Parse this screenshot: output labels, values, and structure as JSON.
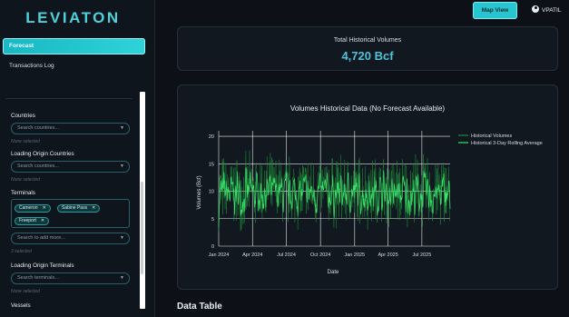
{
  "sidebar": {
    "brand": "LEVIATON",
    "nav": [
      {
        "label": "Forecast",
        "active": true
      },
      {
        "label": "Transactions Log",
        "active": false
      }
    ],
    "filters": {
      "countries": {
        "label": "Countries",
        "placeholder": "Search countries...",
        "hint": "None selected"
      },
      "loading_origin_countries": {
        "label": "Loading Origin Countries",
        "placeholder": "Search countries...",
        "hint": "None selected"
      },
      "terminals": {
        "label": "Terminals",
        "tags": [
          "Cameron",
          "Sabine Pass",
          "Freeport"
        ],
        "add_placeholder": "Search to add more...",
        "hint": "3 selected"
      },
      "loading_origin_terminals": {
        "label": "Loading Origin Terminals",
        "placeholder": "Search terminals...",
        "hint": "None selected"
      },
      "vessels": {
        "label": "Vessels"
      }
    }
  },
  "header": {
    "map_button": "Map View",
    "user": "VPATIL",
    "user_icon": "user-circle-icon"
  },
  "kpi": {
    "label": "Total Historical Volumes",
    "value": "4,720 Bcf"
  },
  "chart_data": {
    "type": "line",
    "title": "Volumes Historical Data (No Forecast Available)",
    "xlabel": "Date",
    "ylabel": "Volumes (Bcf)",
    "x_start": "2024-01-01",
    "x_end": "2025-09-15",
    "xticks": [
      "Jan 2024",
      "Apr 2024",
      "Jul 2024",
      "Oct 2024",
      "Jan 2025",
      "Apr 2025",
      "Jul 2025"
    ],
    "ylim": [
      0,
      21
    ],
    "yticks": [
      0,
      5,
      10,
      15,
      20
    ],
    "grid": true,
    "legend": "top-right",
    "series": [
      {
        "name": "Historical Volumes",
        "color": "#1f8a3a",
        "mean": 10,
        "amplitude": 7
      },
      {
        "name": "Historical 3-Day Rolling Average",
        "color": "#39e36a",
        "mean": 9.5,
        "amplitude": 3.5
      }
    ],
    "colors": {
      "background": "#111820",
      "text": "#d7dee6"
    }
  },
  "data_table": {
    "title": "Data Table"
  }
}
